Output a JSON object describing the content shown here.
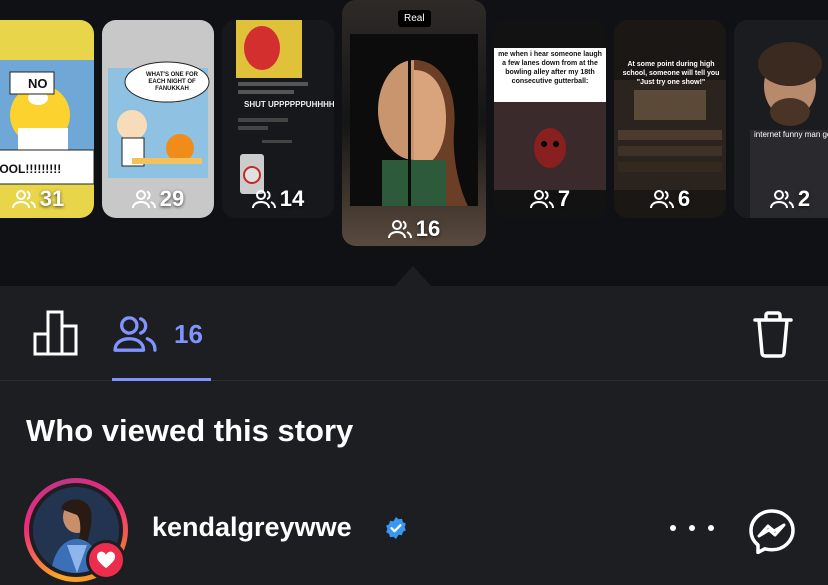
{
  "stories": [
    {
      "viewers": "31",
      "meme_text": "NO",
      "meme_text2": "CHOOL!!!!!!!!!"
    },
    {
      "viewers": "29",
      "meme_text": "WHAT'S ONE FOR EACH NIGHT OF FANUKKAH"
    },
    {
      "viewers": "14",
      "meme_text": "SHUT UPPPPPPUHHHH"
    },
    {
      "viewers": "16",
      "badge": "Real",
      "selected": true
    },
    {
      "viewers": "7",
      "meme_text": "me when i hear someone laugh a few lanes down from at the bowling alley after my 18th consecutive gutterball:"
    },
    {
      "viewers": "6",
      "meme_text": "At some point during high school, someone will tell you \"Just try one show!\""
    },
    {
      "viewers": "2",
      "meme_text": "internet funny man gets mo"
    }
  ],
  "tabs": {
    "viewers_count": "16"
  },
  "section_title": "Who viewed this story",
  "viewer": {
    "username": "kendalgreywwe",
    "verified": true
  },
  "colors": {
    "accent": "#8193ff",
    "background": "#1c1e22",
    "strip": "#101114",
    "heart": "#ed2d4c",
    "verified": "#3897f0"
  }
}
